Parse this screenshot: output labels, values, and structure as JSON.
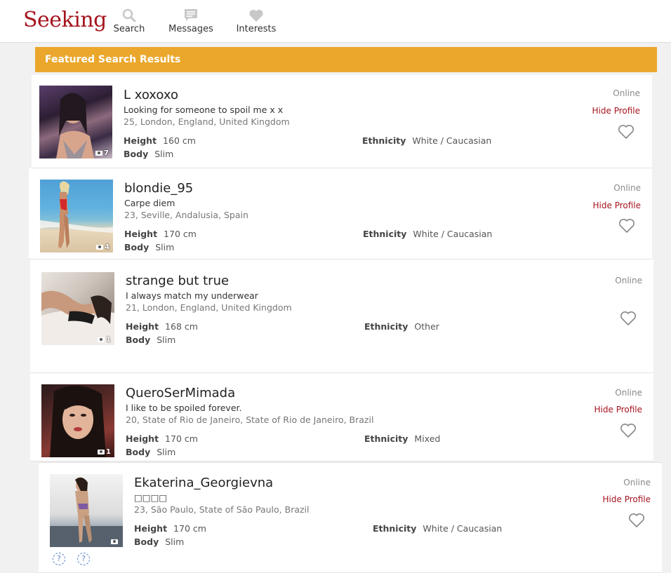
{
  "header": {
    "logo": "Seeking",
    "nav": [
      {
        "label": "Search",
        "icon": "search-icon"
      },
      {
        "label": "Messages",
        "icon": "messages-icon"
      },
      {
        "label": "Interests",
        "icon": "heart-icon"
      }
    ]
  },
  "banner": {
    "title": "Featured Search Results"
  },
  "labels": {
    "height": "Height",
    "body": "Body",
    "ethnicity": "Ethnicity",
    "online": "Online",
    "hide_profile": "Hide Profile"
  },
  "profiles": [
    {
      "username": "L xoxoxo",
      "tagline": "Looking for someone to spoil me x x",
      "location": "25, London, England, United Kingdom",
      "height": "160 cm",
      "body": "Slim",
      "ethnicity": "White / Caucasian",
      "photo_count": "7",
      "status": "Online",
      "show_hide": true
    },
    {
      "username": "blondie_95",
      "tagline": "Carpe diem",
      "location": "23, Seville, Andalusia, Spain",
      "height": "170 cm",
      "body": "Slim",
      "ethnicity": "White / Caucasian",
      "photo_count": "4",
      "status": "Online",
      "show_hide": true
    },
    {
      "username": "strange but true",
      "tagline": "I always match my underwear",
      "location": "21, London, England, United Kingdom",
      "height": "168 cm",
      "body": "Slim",
      "ethnicity": "Other",
      "photo_count": "1",
      "status": "Online",
      "show_hide": false
    },
    {
      "username": "QueroSerMimada",
      "tagline": "I like to be spoiled forever.",
      "location": "20, State of Rio de Janeiro, State of Rio de Janeiro, Brazil",
      "height": "170 cm",
      "body": "Slim",
      "ethnicity": "Mixed",
      "photo_count": "1",
      "status": "Online",
      "show_hide": true
    },
    {
      "username": "Ekaterina_Georgievna",
      "tagline": "□□□□",
      "location": "23, São Paulo, State of São Paulo, Brazil",
      "height": "170 cm",
      "body": "Slim",
      "ethnicity": "White / Caucasian",
      "photo_count": "",
      "status": "Online",
      "show_hide": true,
      "badges": [
        "?",
        "?"
      ]
    }
  ],
  "colors": {
    "brand": "#a5141e",
    "banner": "#eba72b"
  }
}
